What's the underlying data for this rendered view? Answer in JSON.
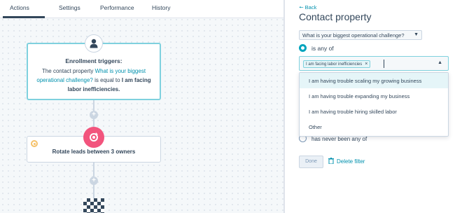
{
  "tabs": [
    {
      "label": "Actions"
    },
    {
      "label": "Settings"
    },
    {
      "label": "Performance"
    },
    {
      "label": "History"
    }
  ],
  "trigger": {
    "title": "Enrollment triggers:",
    "text_before": "The contact property",
    "property_link": "What is your biggest operational challenge?",
    "text_middle": "is equal to",
    "value_bold": "I am facing labor inefficiencies."
  },
  "action": {
    "label": "Rotate leads between 3 owners"
  },
  "panel": {
    "back_label": "Back",
    "title": "Contact property",
    "property_select": "What is your biggest operational challenge?",
    "radio_is_any_of": "is any of",
    "selected_chip": "I am facing labor inefficiencies",
    "options": [
      "I am having trouble scaling my growing business",
      "I am having trouble expanding my business",
      "I am having trouble hiring skilled labor",
      "Other"
    ],
    "partial_radio_label": "has never been any of",
    "done_label": "Done",
    "delete_label": "Delete filter"
  },
  "colors": {
    "accent": "#00a4bd",
    "link": "#0091ae",
    "rotate_icon": "#f2547d",
    "text": "#33475b"
  }
}
